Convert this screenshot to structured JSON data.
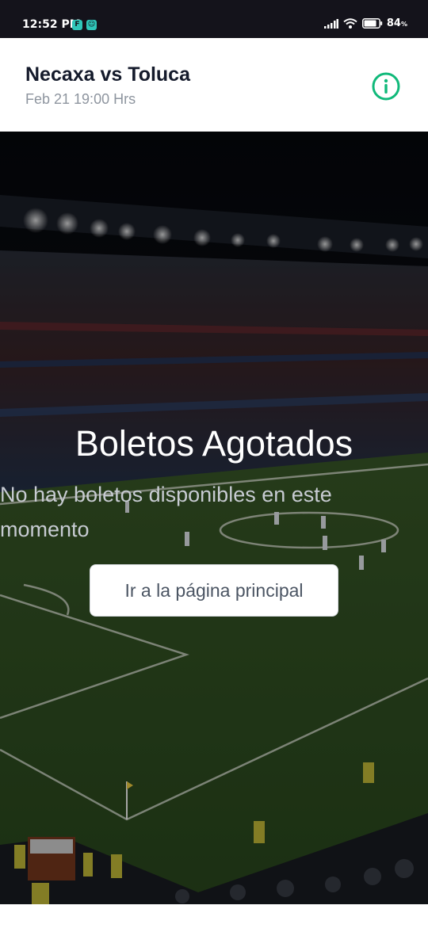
{
  "status_bar": {
    "time": "12:52 PM",
    "app_icons": [
      "F",
      "☺"
    ],
    "battery_level": "84",
    "battery_unit": "%",
    "battery_fraction": 0.84,
    "icons": [
      "signal-icon",
      "wifi-icon",
      "battery-icon"
    ]
  },
  "header": {
    "title": "Necaxa vs Toluca",
    "subtitle": "Feb 21 19:00 Hrs",
    "info_icon": "info-icon",
    "accent_color": "#10b97a"
  },
  "hero": {
    "background": "stadium-image",
    "title": "Boletos Agotados",
    "message": "No hay boletos disponibles en este momento",
    "button_label": "Ir a la página principal"
  },
  "colors": {
    "status_bar_bg": "#14131b",
    "title_text": "#141a2b",
    "subtitle_text": "#8e959f",
    "hero_text": "#c7cbd2"
  }
}
